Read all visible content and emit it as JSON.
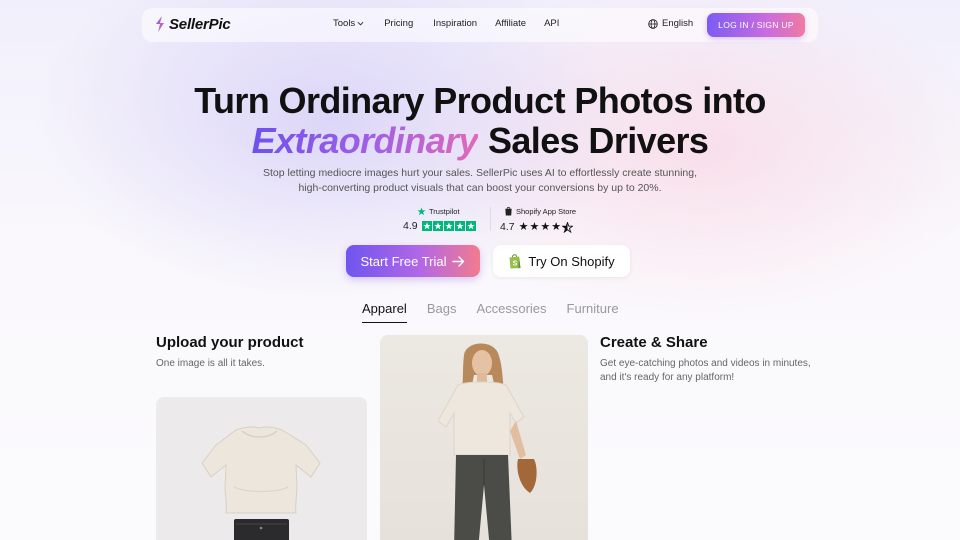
{
  "nav": {
    "logo_text": "SellerPic",
    "links": [
      "Tools",
      "Pricing",
      "Inspiration",
      "Affiliate",
      "API"
    ],
    "language": "English",
    "login_label": "LOG IN / SIGN UP"
  },
  "hero": {
    "title_line1": "Turn Ordinary Product Photos into",
    "title_accent": "Extraordinary",
    "title_line2_rest": "Sales Drivers",
    "subtitle": "Stop letting mediocre images hurt your sales. SellerPic uses AI to effortlessly create stunning, high-converting product visuals that can boost your conversions by up to 20%."
  },
  "ratings": {
    "trustpilot": {
      "brand": "Trustpilot",
      "score": "4.9"
    },
    "shopify": {
      "brand": "Shopify App Store",
      "score": "4.7"
    }
  },
  "cta": {
    "primary": "Start Free Trial",
    "secondary": "Try On Shopify"
  },
  "tabs": [
    {
      "label": "Apparel",
      "active": true
    },
    {
      "label": "Bags",
      "active": false
    },
    {
      "label": "Accessories",
      "active": false
    },
    {
      "label": "Furniture",
      "active": false
    }
  ],
  "upload": {
    "title": "Upload your product",
    "desc": "One image is all it takes."
  },
  "share": {
    "title": "Create & Share",
    "desc": "Get eye-catching photos and videos in minutes, and it's ready for any platform!"
  },
  "colors": {
    "accent_start": "#6f55f0",
    "accent_end": "#f27b8e",
    "trustpilot_green": "#00b67a",
    "shopify_green": "#95bf47"
  },
  "icons": [
    "logo-mark-icon",
    "chevron-down-icon",
    "globe-icon",
    "trustpilot-star-icon",
    "shopify-bag-icon",
    "arrow-right-icon"
  ]
}
